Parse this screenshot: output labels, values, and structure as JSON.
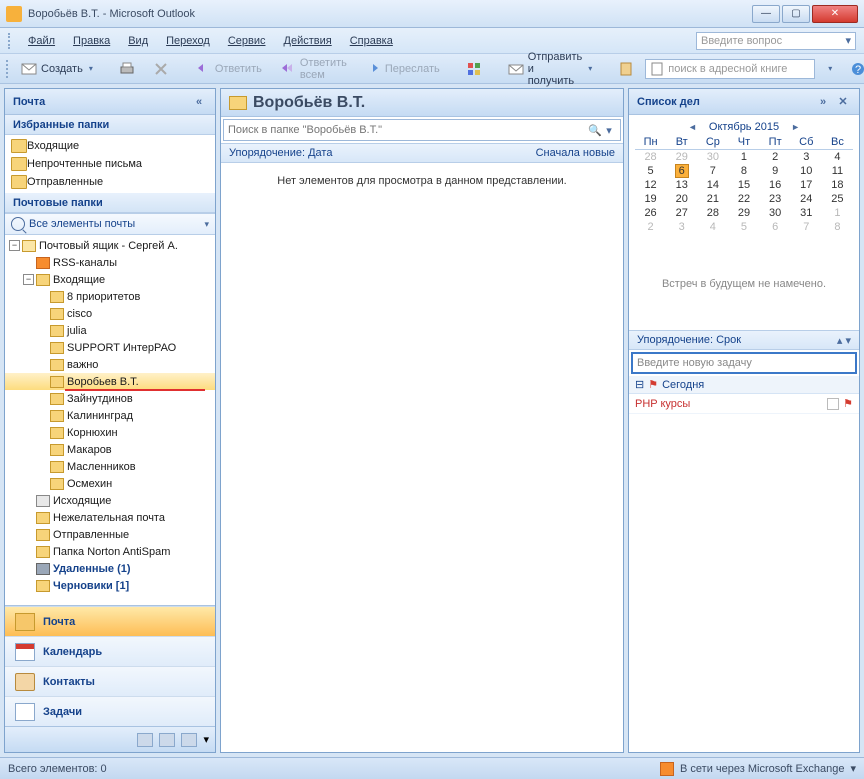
{
  "window": {
    "title": "Воробьёв В.Т. - Microsoft Outlook"
  },
  "menu": {
    "file": "Файл",
    "edit": "Правка",
    "view": "Вид",
    "go": "Переход",
    "tools": "Сервис",
    "actions": "Действия",
    "help": "Справка",
    "askbox": "Введите вопрос"
  },
  "toolbar": {
    "create": "Создать",
    "reply": "Ответить",
    "replyall": "Ответить всем",
    "forward": "Переслать",
    "sendrecv": "Отправить и получить",
    "absearch": "поиск в адресной книге"
  },
  "nav": {
    "title": "Почта",
    "fav_hdr": "Избранные папки",
    "fav": [
      "Входящие",
      "Непрочтенные письма",
      "Отправленные"
    ],
    "mailfolders_hdr": "Почтовые папки",
    "allitems": "Все элементы почты",
    "mailbox": "Почтовый ящик - Сергей А.",
    "rss": "RSS-каналы",
    "inbox": "Входящие",
    "sub": [
      "8 приоритетов",
      "cisco",
      "julia",
      "SUPPORT ИнтерРАО",
      "важно",
      "Воробьев В.Т.",
      "Зайнутдинов",
      "Калининград",
      "Корнюхин",
      "Макаров",
      "Масленников",
      "Осмехин"
    ],
    "outbox": "Исходящие",
    "junk": "Нежелательная почта",
    "sent": "Отправленные",
    "norton": "Папка Norton AntiSpam",
    "deleted": "Удаленные (1)",
    "drafts": "Черновики [1]",
    "btn_mail": "Почта",
    "btn_cal": "Календарь",
    "btn_con": "Контакты",
    "btn_task": "Задачи"
  },
  "mid": {
    "folder": "Воробьёв В.Т.",
    "search_ph": "Поиск в папке \"Воробьёв В.Т.\"",
    "sort_l": "Упорядочение: Дата",
    "sort_r": "Сначала новые",
    "empty": "Нет элементов для просмотра в данном представлении."
  },
  "todo": {
    "title": "Список дел",
    "month": "Октябрь 2015",
    "dow": [
      "Пн",
      "Вт",
      "Ср",
      "Чт",
      "Пт",
      "Сб",
      "Вс"
    ],
    "weeks": [
      [
        {
          "d": 28,
          "dim": 1
        },
        {
          "d": 29,
          "dim": 1
        },
        {
          "d": 30,
          "dim": 1
        },
        {
          "d": 1
        },
        {
          "d": 2
        },
        {
          "d": 3
        },
        {
          "d": 4
        }
      ],
      [
        {
          "d": 5
        },
        {
          "d": 6,
          "today": 1
        },
        {
          "d": 7
        },
        {
          "d": 8
        },
        {
          "d": 9
        },
        {
          "d": 10
        },
        {
          "d": 11
        }
      ],
      [
        {
          "d": 12
        },
        {
          "d": 13
        },
        {
          "d": 14
        },
        {
          "d": 15
        },
        {
          "d": 16
        },
        {
          "d": 17
        },
        {
          "d": 18
        }
      ],
      [
        {
          "d": 19
        },
        {
          "d": 20
        },
        {
          "d": 21
        },
        {
          "d": 22
        },
        {
          "d": 23
        },
        {
          "d": 24
        },
        {
          "d": 25
        }
      ],
      [
        {
          "d": 26
        },
        {
          "d": 27
        },
        {
          "d": 28
        },
        {
          "d": 29
        },
        {
          "d": 30
        },
        {
          "d": 31
        },
        {
          "d": 1,
          "dim": 1
        }
      ],
      [
        {
          "d": 2,
          "dim": 1
        },
        {
          "d": 3,
          "dim": 1
        },
        {
          "d": 4,
          "dim": 1
        },
        {
          "d": 5,
          "dim": 1
        },
        {
          "d": 6,
          "dim": 1
        },
        {
          "d": 7,
          "dim": 1
        },
        {
          "d": 8,
          "dim": 1
        }
      ]
    ],
    "nomtg": "Встреч в будущем не намечено.",
    "task_sort": "Упорядочение: Срок",
    "newtask_ph": "Введите новую задачу",
    "group": "Сегодня",
    "task0": "PHP курсы"
  },
  "status": {
    "left": "Всего элементов: 0",
    "right": "В сети через Microsoft Exchange"
  }
}
